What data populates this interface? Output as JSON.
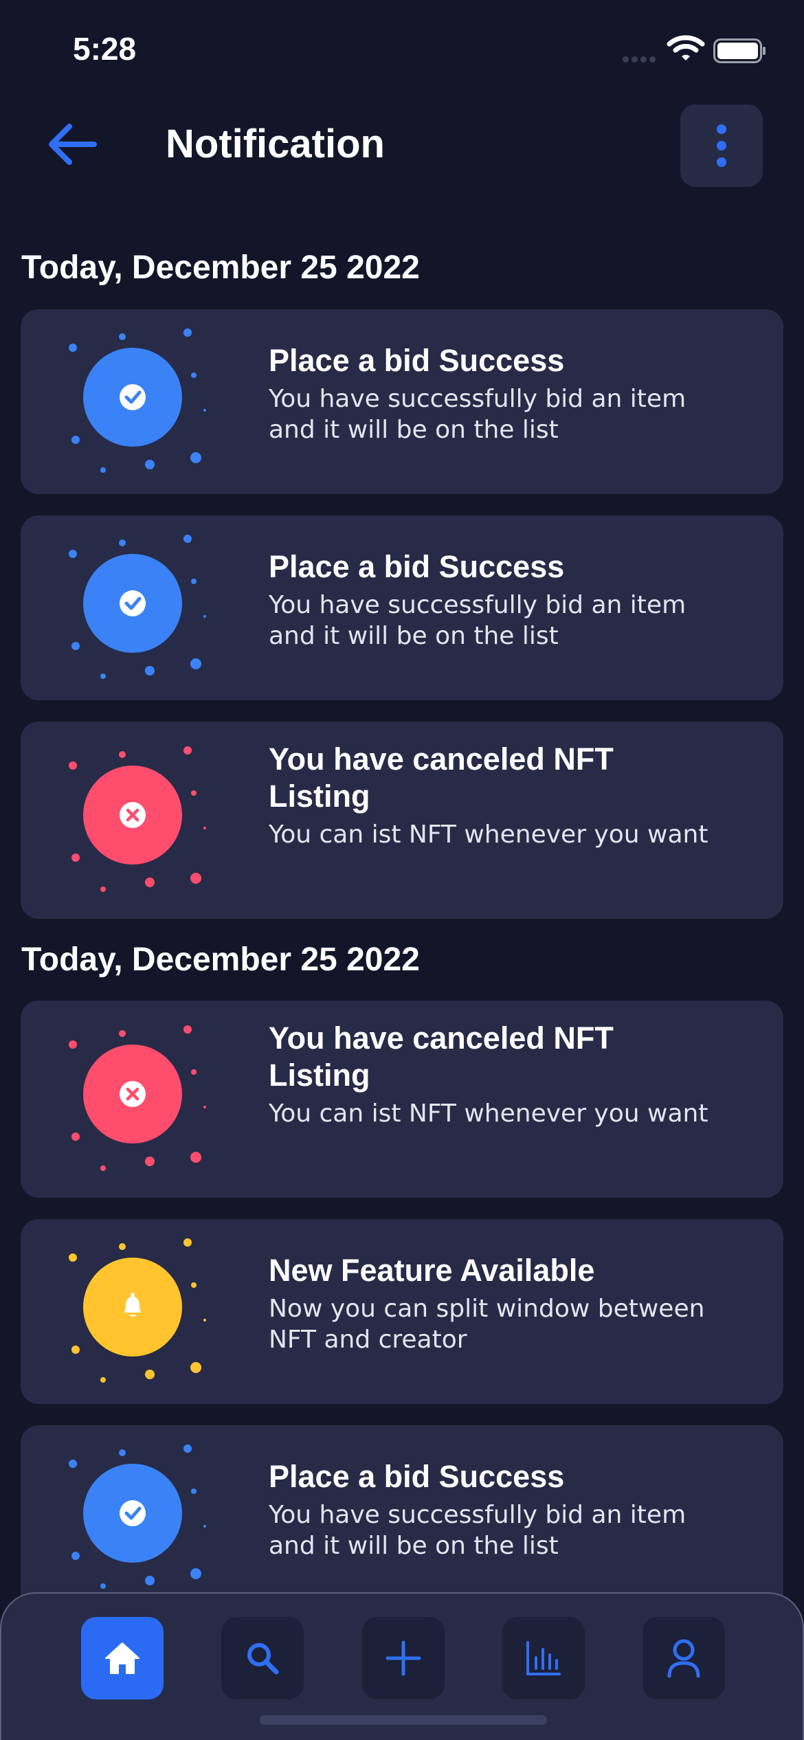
{
  "status_bar": {
    "time": "5:28"
  },
  "header": {
    "title": "Notification"
  },
  "sections": [
    {
      "title": "Today, December 25 2022"
    },
    {
      "title": "Today, December 25 2022"
    }
  ],
  "notifications": [
    {
      "type": "success",
      "color": "#3b82f6",
      "title": "Place a bid Success",
      "body": "You have successfully bid an item and it will be on the list"
    },
    {
      "type": "success",
      "color": "#3b82f6",
      "title": "Place a bid Success",
      "body": "You have successfully bid an item and it will be on the list"
    },
    {
      "type": "canceled",
      "color": "#ff4d6d",
      "title": "You have canceled NFT Listing",
      "body": "You can ist NFT whenever you want"
    },
    {
      "type": "canceled",
      "color": "#ff4d6d",
      "title": "You have canceled NFT Listing",
      "body": "You can ist NFT whenever you want"
    },
    {
      "type": "feature",
      "color": "#ffc42e",
      "title": "New Feature Available",
      "body": "Now you can split window between NFT and creator"
    },
    {
      "type": "success",
      "color": "#3b82f6",
      "title": "Place a bid Success",
      "body": "You have successfully bid an item and it will be on the list"
    }
  ],
  "tab_bar": {
    "active": "home",
    "tabs": [
      {
        "id": "home",
        "icon": "home-icon"
      },
      {
        "id": "search",
        "icon": "search-icon"
      },
      {
        "id": "create",
        "icon": "plus-icon"
      },
      {
        "id": "stats",
        "icon": "bar-chart-icon"
      },
      {
        "id": "profile",
        "icon": "user-icon"
      }
    ]
  },
  "colors": {
    "background": "#121628",
    "card": "#272b47",
    "accent": "#2b6bf3",
    "success": "#3b82f6",
    "danger": "#ff4d6d",
    "warning": "#ffc42e"
  }
}
